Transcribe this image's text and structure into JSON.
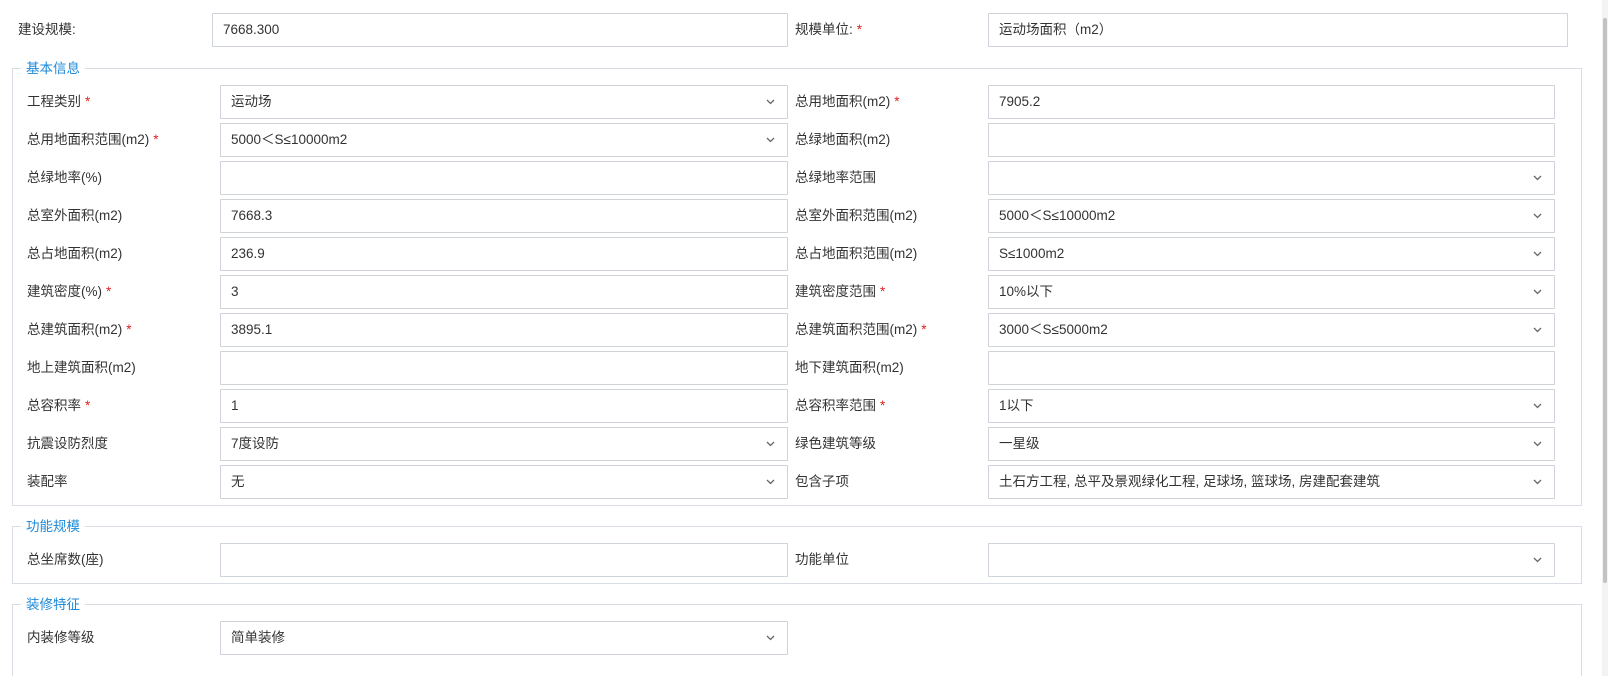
{
  "top": {
    "scale_label": "建设规模:",
    "scale_value": "7668.300",
    "unit_label": "规模单位:",
    "unit_value": "运动场面积（m2）"
  },
  "sections": {
    "basic": "基本信息",
    "function": "功能规模",
    "decoration": "装修特征"
  },
  "required_mark": "*",
  "basic": {
    "engineering_type": {
      "label": "工程类别",
      "value": "运动场"
    },
    "total_land_area": {
      "label": "总用地面积(m2)",
      "value": "7905.2"
    },
    "land_area_range": {
      "label": "总用地面积范围(m2)",
      "value": "5000＜S≤10000m2"
    },
    "green_area": {
      "label": "总绿地面积(m2)",
      "value": ""
    },
    "green_rate": {
      "label": "总绿地率(%)",
      "value": ""
    },
    "green_rate_range": {
      "label": "总绿地率范围",
      "value": ""
    },
    "outdoor_area": {
      "label": "总室外面积(m2)",
      "value": "7668.3"
    },
    "outdoor_area_range": {
      "label": "总室外面积范围(m2)",
      "value": "5000＜S≤10000m2"
    },
    "footprint_area": {
      "label": "总占地面积(m2)",
      "value": "236.9"
    },
    "footprint_range": {
      "label": "总占地面积范围(m2)",
      "value": "S≤1000m2"
    },
    "building_density": {
      "label": "建筑密度(%)",
      "value": "3"
    },
    "density_range": {
      "label": "建筑密度范围",
      "value": "10%以下"
    },
    "building_area": {
      "label": "总建筑面积(m2)",
      "value": "3895.1"
    },
    "building_area_range": {
      "label": "总建筑面积范围(m2)",
      "value": "3000＜S≤5000m2"
    },
    "above_ground_area": {
      "label": "地上建筑面积(m2)",
      "value": ""
    },
    "underground_area": {
      "label": "地下建筑面积(m2)",
      "value": ""
    },
    "plot_ratio": {
      "label": "总容积率",
      "value": "1"
    },
    "plot_ratio_range": {
      "label": "总容积率范围",
      "value": "1以下"
    },
    "seismic": {
      "label": "抗震设防烈度",
      "value": "7度设防"
    },
    "green_grade": {
      "label": "绿色建筑等级",
      "value": "一星级"
    },
    "assembly_rate": {
      "label": "装配率",
      "value": "无"
    },
    "sub_items": {
      "label": "包含子项",
      "value": "土石方工程, 总平及景观绿化工程, 足球场, 篮球场, 房建配套建筑"
    }
  },
  "function": {
    "seats": {
      "label": "总坐席数(座)",
      "value": ""
    },
    "func_unit": {
      "label": "功能单位",
      "value": ""
    }
  },
  "decoration": {
    "interior_grade": {
      "label": "内装修等级",
      "value": "简单装修"
    }
  }
}
